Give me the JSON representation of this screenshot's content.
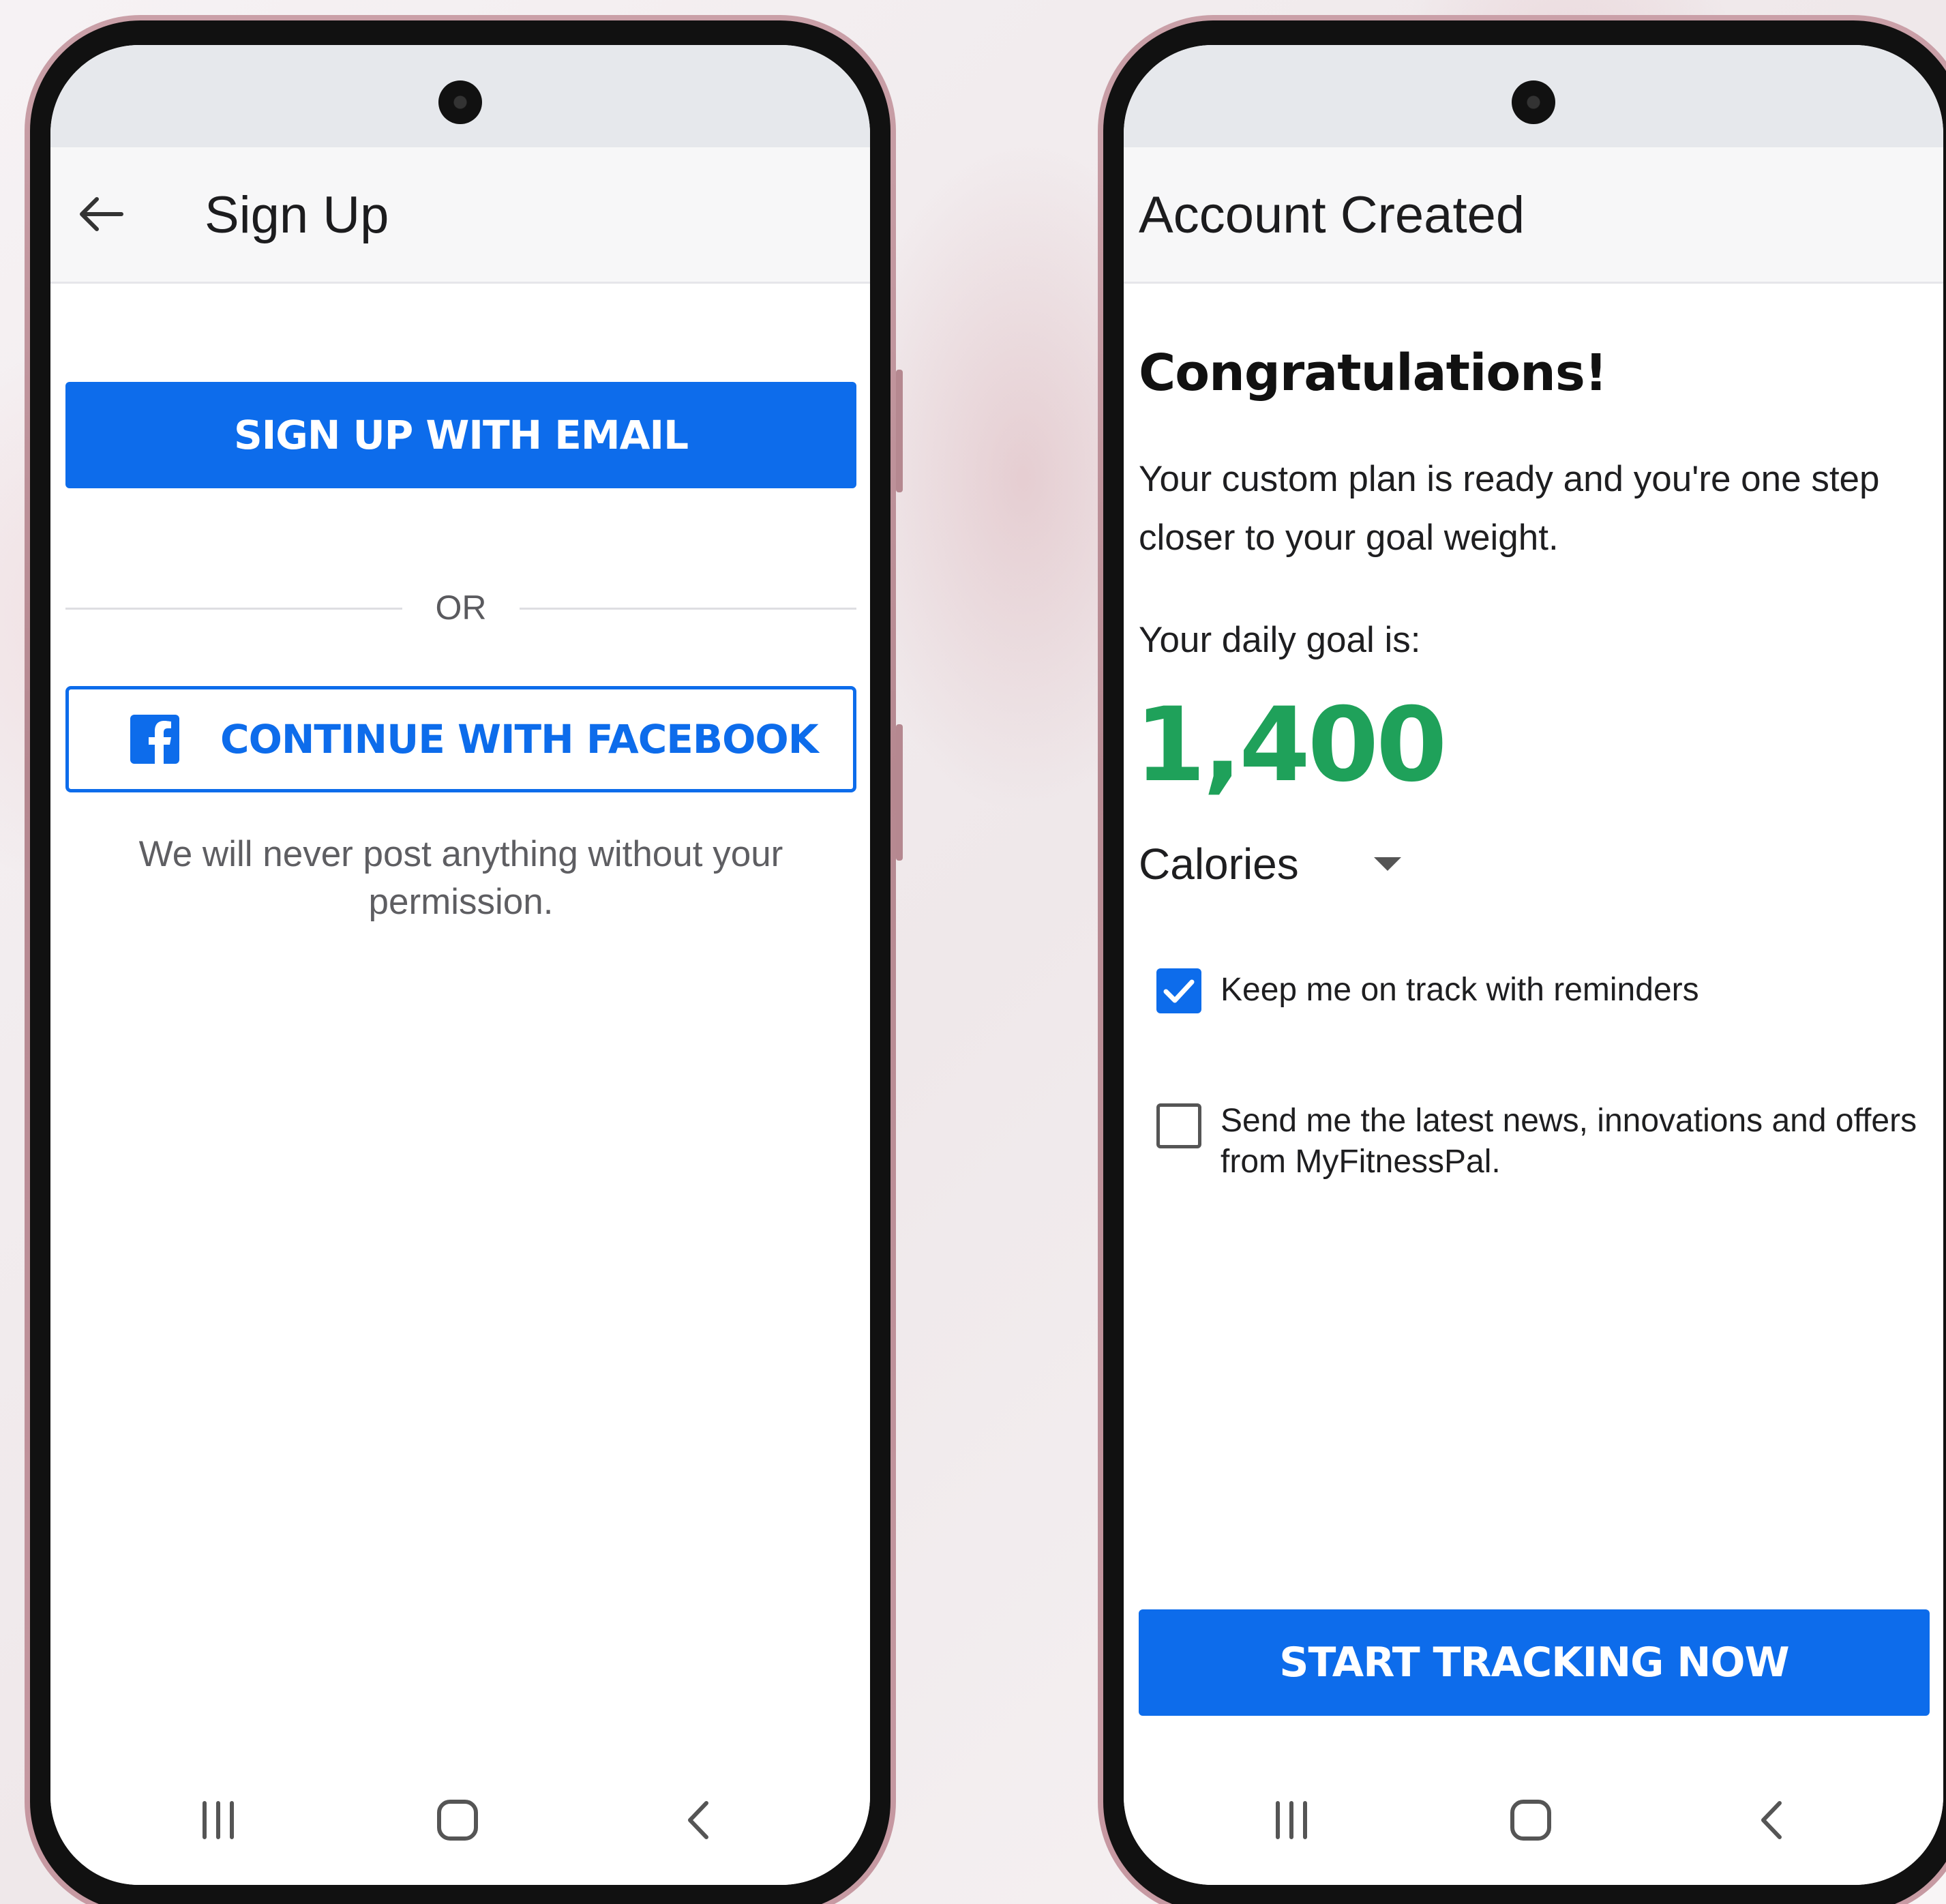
{
  "left_screen": {
    "title": "Sign Up",
    "email_button": "SIGN UP WITH EMAIL",
    "divider_text": "OR",
    "facebook_button": "CONTINUE WITH FACEBOOK",
    "privacy_note": "We will never post anything without your permission."
  },
  "right_screen": {
    "title": "Account Created",
    "heading": "Congratulations!",
    "plan_message": "Your custom plan is ready and you're one step closer to your goal weight.",
    "daily_goal_label": "Your daily goal is:",
    "daily_goal_value": "1,400",
    "unit_selected": "Calories",
    "reminders_label": "Keep me on track with reminders",
    "reminders_checked": true,
    "news_label": "Send me the latest news, innovations and offers from MyFitnessPal.",
    "news_checked": false,
    "start_button": "START TRACKING NOW"
  },
  "icons": [
    "back-arrow-icon",
    "facebook-icon",
    "chevron-down-icon",
    "checkmark-icon",
    "recent-apps-icon",
    "home-icon",
    "back-icon"
  ],
  "colors": {
    "accent_blue": "#0d6ceb",
    "goal_green": "#1fa15a",
    "phone_frame": "#b58890"
  }
}
